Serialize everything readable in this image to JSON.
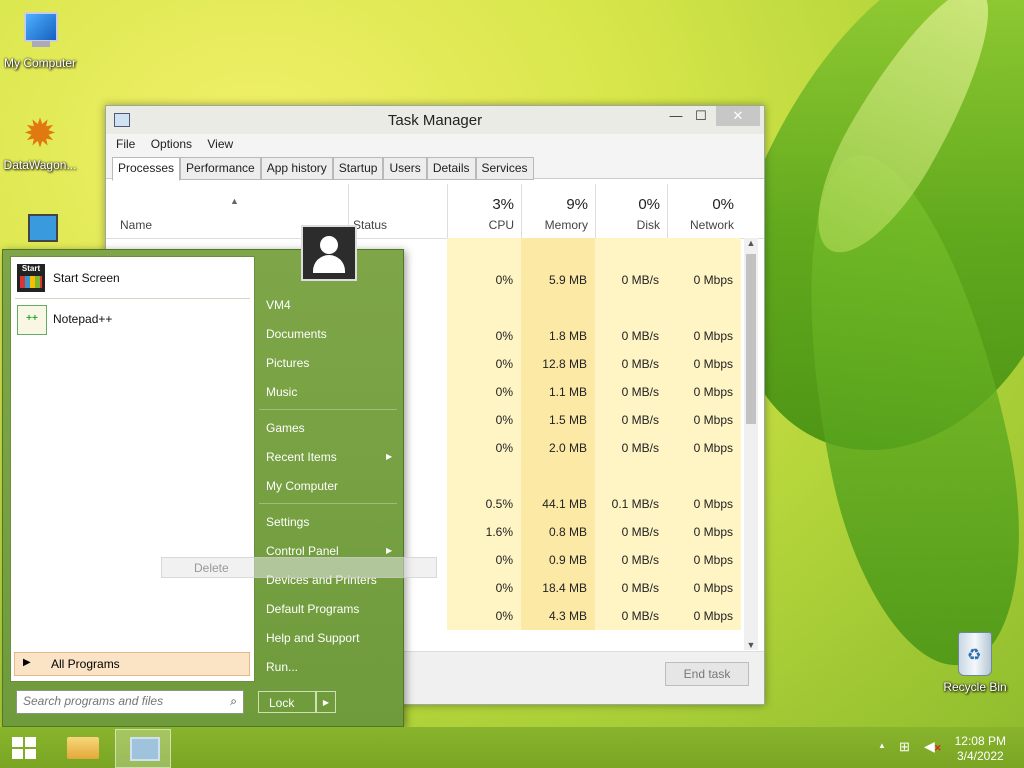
{
  "desktop": {
    "icons": [
      {
        "label": "My Computer"
      },
      {
        "label": "DataWagon..."
      },
      {
        "label": "Recycle Bin"
      }
    ]
  },
  "task_manager": {
    "title": "Task Manager",
    "menu": [
      "File",
      "Options",
      "View"
    ],
    "tabs": [
      "Processes",
      "Performance",
      "App history",
      "Startup",
      "Users",
      "Details",
      "Services"
    ],
    "columns": {
      "name": "Name",
      "status": "Status",
      "cpu": {
        "pct": "3%",
        "label": "CPU"
      },
      "memory": {
        "pct": "9%",
        "label": "Memory"
      },
      "disk": {
        "pct": "0%",
        "label": "Disk"
      },
      "network": {
        "pct": "0%",
        "label": "Network"
      }
    },
    "rows": [
      {
        "cpu": "",
        "mem": "",
        "disk": "",
        "net": ""
      },
      {
        "cpu": "0%",
        "mem": "5.9 MB",
        "disk": "0 MB/s",
        "net": "0 Mbps"
      },
      {
        "cpu": "",
        "mem": "",
        "disk": "",
        "net": ""
      },
      {
        "cpu": "0%",
        "mem": "1.8 MB",
        "disk": "0 MB/s",
        "net": "0 Mbps"
      },
      {
        "cpu": "0%",
        "mem": "12.8 MB",
        "disk": "0 MB/s",
        "net": "0 Mbps"
      },
      {
        "cpu": "0%",
        "mem": "1.1 MB",
        "disk": "0 MB/s",
        "net": "0 Mbps"
      },
      {
        "cpu": "0%",
        "mem": "1.5 MB",
        "disk": "0 MB/s",
        "net": "0 Mbps"
      },
      {
        "cpu": "0%",
        "mem": "2.0 MB",
        "disk": "0 MB/s",
        "net": "0 Mbps"
      },
      {
        "cpu": "",
        "mem": "",
        "disk": "",
        "net": ""
      },
      {
        "cpu": "0.5%",
        "mem": "44.1 MB",
        "disk": "0.1 MB/s",
        "net": "0 Mbps"
      },
      {
        "cpu": "1.6%",
        "mem": "0.8 MB",
        "disk": "0 MB/s",
        "net": "0 Mbps"
      },
      {
        "cpu": "0%",
        "mem": "0.9 MB",
        "disk": "0 MB/s",
        "net": "0 Mbps"
      },
      {
        "cpu": "0%",
        "mem": "18.4 MB",
        "disk": "0 MB/s",
        "net": "0 Mbps"
      },
      {
        "cpu": "0%",
        "mem": "4.3 MB",
        "disk": "0 MB/s",
        "net": "0 Mbps"
      }
    ],
    "end_task": "End task"
  },
  "start_menu": {
    "pinned": [
      {
        "label": "Start Screen",
        "icon": "start-screen-icon"
      },
      {
        "label": "Notepad++",
        "icon": "notepad-plus-plus-icon"
      }
    ],
    "all_programs": "All Programs",
    "search_placeholder": "Search programs and files",
    "right_items": [
      {
        "label": "VM4",
        "submenu": false
      },
      {
        "label": "Documents",
        "submenu": false
      },
      {
        "label": "Pictures",
        "submenu": false
      },
      {
        "label": "Music",
        "submenu": false
      },
      {
        "label": "Games",
        "submenu": false
      },
      {
        "label": "Recent Items",
        "submenu": true
      },
      {
        "label": "My Computer",
        "submenu": false
      },
      {
        "label": "Settings",
        "submenu": false
      },
      {
        "label": "Control Panel",
        "submenu": true
      },
      {
        "label": "Devices and Printers",
        "submenu": false
      },
      {
        "label": "Default Programs",
        "submenu": false
      },
      {
        "label": "Help and Support",
        "submenu": false
      },
      {
        "label": "Run...",
        "submenu": false
      }
    ],
    "lock": "Lock",
    "context_delete": "Delete"
  },
  "taskbar": {
    "time": "12:08 PM",
    "date": "3/4/2022"
  }
}
